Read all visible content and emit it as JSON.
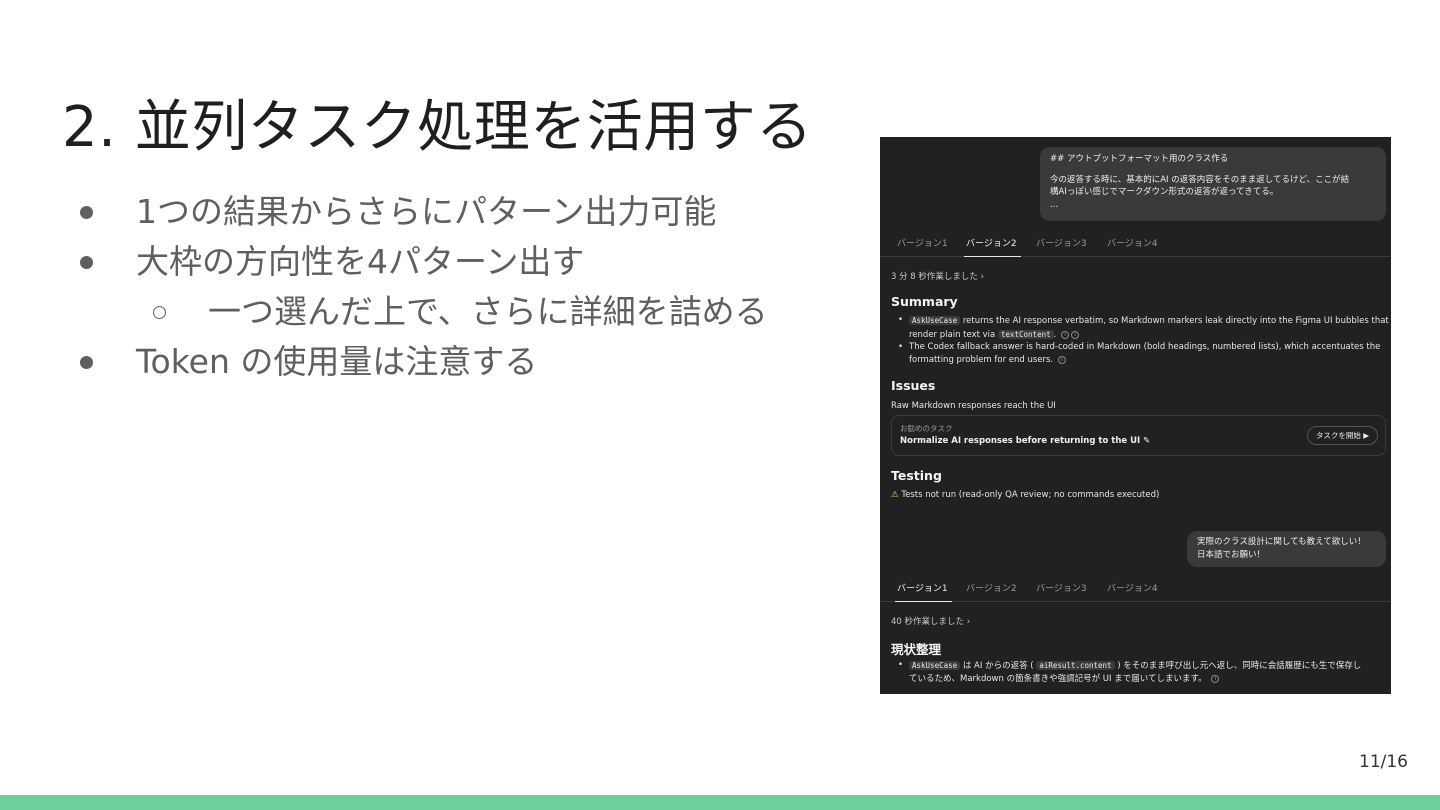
{
  "slide": {
    "title": "2. 並列タスク処理を活用する",
    "bullets": [
      "1つの結果からさらにパターン出力可能",
      "大枠の方向性を4パターン出す",
      "一つ選んだ上で、さらに詳細を詰める",
      "Token の使用量は注意する"
    ],
    "page_number": "11/16",
    "accent_color": "#6ecf9b"
  },
  "screenshot": {
    "bubble1": {
      "line1": "## アウトプットフォーマット用のクラス作る",
      "line2": "今の返答する時に、基本的にAI の返答内容をそのまま返してるけど、ここが結",
      "line3": "構AIっぽい感じでマークダウン形式の返答が返ってきてる。",
      "line4": "..."
    },
    "tabs_top": [
      "バージョン1",
      "バージョン2",
      "バージョン3",
      "バージョン4"
    ],
    "tabs_top_active": "バージョン2",
    "worked_top": "3 分 8 秒作業しました",
    "summary": {
      "heading": "Summary",
      "item1_code1": "AskUseCase",
      "item1_text1": "returns the AI response verbatim, so Markdown markers leak directly into the Figma UI bubbles that",
      "item1_text2": "render plain text via",
      "item1_code2": "textContent",
      "item2_line1": "The Codex fallback answer is hard-coded in Markdown (bold headings, numbered lists), which accentuates the",
      "item2_line2": "formatting problem for end users."
    },
    "issues": {
      "heading": "Issues",
      "text": "Raw Markdown responses reach the UI",
      "task_label": "お勧めのタスク",
      "task_title": "Normalize AI responses before returning to the UI",
      "task_button": "タスクを開始"
    },
    "testing": {
      "heading": "Testing",
      "text": "Tests not run (read-only QA review; no commands executed)"
    },
    "bubble2": {
      "line1": "実際のクラス設計に関しても教えて欲しい！",
      "line2": "日本語でお願い！"
    },
    "tabs_bottom": [
      "バージョン1",
      "バージョン2",
      "バージョン3",
      "バージョン4"
    ],
    "tabs_bottom_active": "バージョン1",
    "worked_bottom": "40 秒作業しました",
    "status": {
      "heading": "現状整理",
      "code1": "AskUseCase",
      "text1": "は AI からの返答 (",
      "code2": "aiResult.content",
      "text2": ") をそのまま呼び出し元へ返し、同時に会話履歴にも生で保存し",
      "line2": "ているため、Markdown の箇条書きや強調記号が UI まで届いてしまいます。"
    }
  }
}
